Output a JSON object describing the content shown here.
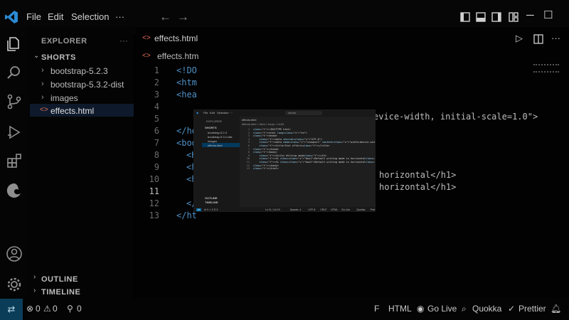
{
  "menu": {
    "file": "File",
    "edit": "Edit",
    "selection": "Selection",
    "more": "···"
  },
  "icons": {
    "logo": "vscode-logo",
    "back": "arrow-left-icon",
    "forward": "arrow-right-icon",
    "layout": [
      "toggle-sidebar-icon",
      "toggle-panel-icon",
      "toggle-secondary-sidebar-icon",
      "customize-layout-icon"
    ],
    "run": "run-icon",
    "split": "split-editor-icon"
  },
  "colors": {
    "remote": "#0b3d58",
    "tag": "#4f8fc4",
    "selection": "#0e1a2b"
  },
  "sidebar": {
    "explorer_title": "EXPLORER",
    "more": "···",
    "section": "SHORTS",
    "items": [
      {
        "label": "bootstrap-5.2.3",
        "type": "folder"
      },
      {
        "label": "bootstrap-5.3.2-dist",
        "type": "folder"
      },
      {
        "label": "images",
        "type": "folder"
      },
      {
        "label": "effects.html",
        "type": "file",
        "icon": "<>"
      }
    ],
    "outline": "OUTLINE",
    "timeline": "TIMELINE"
  },
  "editor": {
    "tab_label": "effects.html",
    "breadcrumb_file": "effects.htm",
    "line_numbers": [
      "1",
      "2",
      "3",
      "4",
      "5",
      "6",
      "7",
      "8",
      "9",
      "10",
      "11",
      "12",
      "13"
    ],
    "visible_lines": {
      "l1": "<!DO",
      "l2": "<htm",
      "l3": "<hea",
      "l6": "</he",
      "l7": "<bod",
      "l8": "<H",
      "l9": "<h",
      "l10": "<h",
      "l12": "</b",
      "l13": "</ht"
    },
    "right_fragments": {
      "viewport": "evice-width, initial-scale=1.0\">",
      "h1_a": "horizontal</h1>",
      "h1_b": "horizontal</h1>"
    }
  },
  "status": {
    "remote": "⇄",
    "errors": "0",
    "warnings": "0",
    "ports": "0",
    "items": [
      "F",
      "HTML",
      "Go Live",
      "Quokka",
      "Prettier"
    ]
  },
  "inset": {
    "menu": [
      "File",
      "Edit",
      "Selection",
      "···"
    ],
    "search": "shorts",
    "explorer": "EXPLORER",
    "section": "SHORTS",
    "items": [
      "bootstrap-5.2.3",
      "bootstrap-5.3.2-dist",
      "images",
      "effects.html"
    ],
    "outline": "OUTLINE",
    "timeline": "TIMELINE",
    "tab": "effects.html",
    "breadcrumb": "effects.html > html > body > h1#2",
    "lines": [
      "<!DOCTYPE html>",
      "<html lang=\"en\">",
      "<head>",
      "    <meta charset=\"UTF-8\">",
      "    <meta name=\"viewport\" content=\"width=device-width, initial-scale=1.0\">",
      "    <title>Text effects</title>",
      "</head>",
      "<body>",
      "    <h1>Css Writing mode</h1>",
      "    <h1 class=\"box1\">Default writing mode is horizontal</h1>",
      "    <h1 class=\"box2\">Default writing mode is horizontal</h1>",
      "</body>",
      "</html>"
    ],
    "status_left": "⊗ 0 ⚠ 0  ⚲ 0",
    "status_right": [
      "Ln 11, Col 19",
      "Spaces: 4",
      "UTF-8",
      "CRLF",
      "HTML",
      "Go Live",
      "Quokka",
      "Prettier"
    ]
  }
}
